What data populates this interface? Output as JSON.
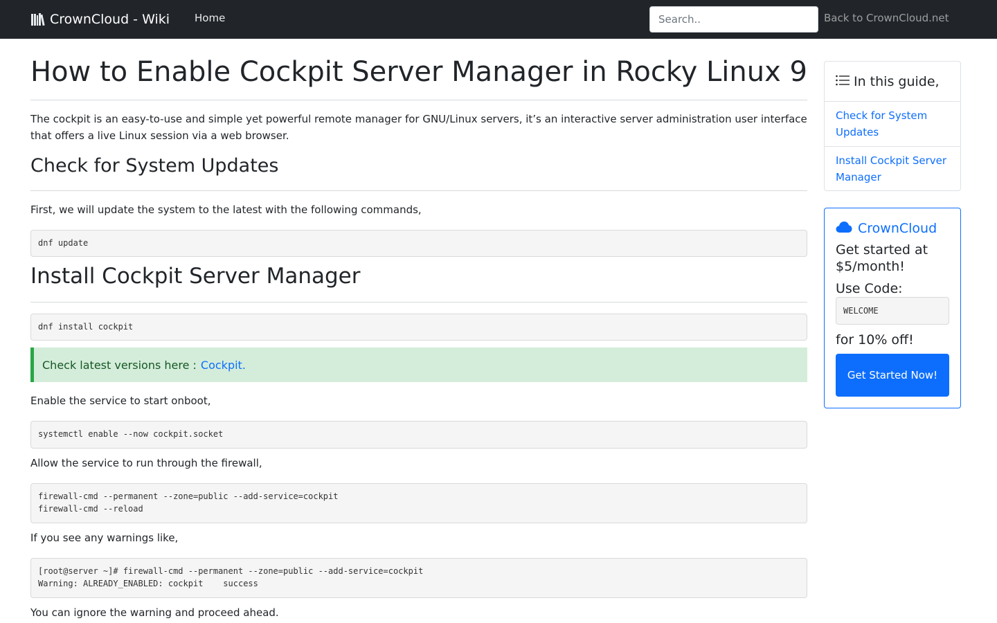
{
  "navbar": {
    "brand": "CrownCloud - Wiki",
    "home_label": "Home",
    "search_placeholder": "Search..",
    "back_label": "Back to CrownCloud.net"
  },
  "article": {
    "title": "How to Enable Cockpit Server Manager in Rocky Linux 9",
    "intro": "The cockpit is an easy-to-use and simple yet powerful remote manager for GNU/Linux servers, it’s an interactive server administration user interface that offers a live Linux session via a web browser.",
    "section1_heading": "Check for System Updates",
    "section1_text": "First, we will update the system to the latest with the following commands,",
    "code_update": "dnf update",
    "section2_heading": "Install Cockpit Server Manager",
    "code_install": "dnf install cockpit",
    "alert_text": "Check latest versions here :",
    "alert_link": "Cockpit.",
    "enable_text": "Enable the service to start onboot,",
    "code_enable": "systemctl enable --now cockpit.socket",
    "firewall_text": "Allow the service to run through the firewall,",
    "code_firewall": "firewall-cmd --permanent --zone=public --add-service=cockpit\nfirewall-cmd --reload",
    "warning_text": "If you see any warnings like,",
    "code_warning": "[root@server ~]# firewall-cmd --permanent --zone=public --add-service=cockpit\nWarning: ALREADY_ENABLED: cockpit    success",
    "ignore_text": "You can ignore the warning and proceed ahead."
  },
  "toc": {
    "heading": "In this guide,",
    "items": [
      {
        "label": "Check for System Updates"
      },
      {
        "label": "Install Cockpit Server Manager"
      }
    ]
  },
  "promo": {
    "brand": "CrownCloud",
    "line1": "Get started at $5/month!",
    "line2": "Use Code:",
    "code": "WELCOME",
    "line3": "for 10% off!",
    "button": "Get Started Now!"
  },
  "colors": {
    "navbar_bg": "#212529",
    "link": "#0d6efd",
    "alert_bg": "#d4edda",
    "alert_border": "#28a745",
    "code_bg": "#f5f5f5"
  },
  "icons": {
    "brand": "books-icon",
    "toc": "list-icon",
    "promo": "cloud-icon"
  }
}
